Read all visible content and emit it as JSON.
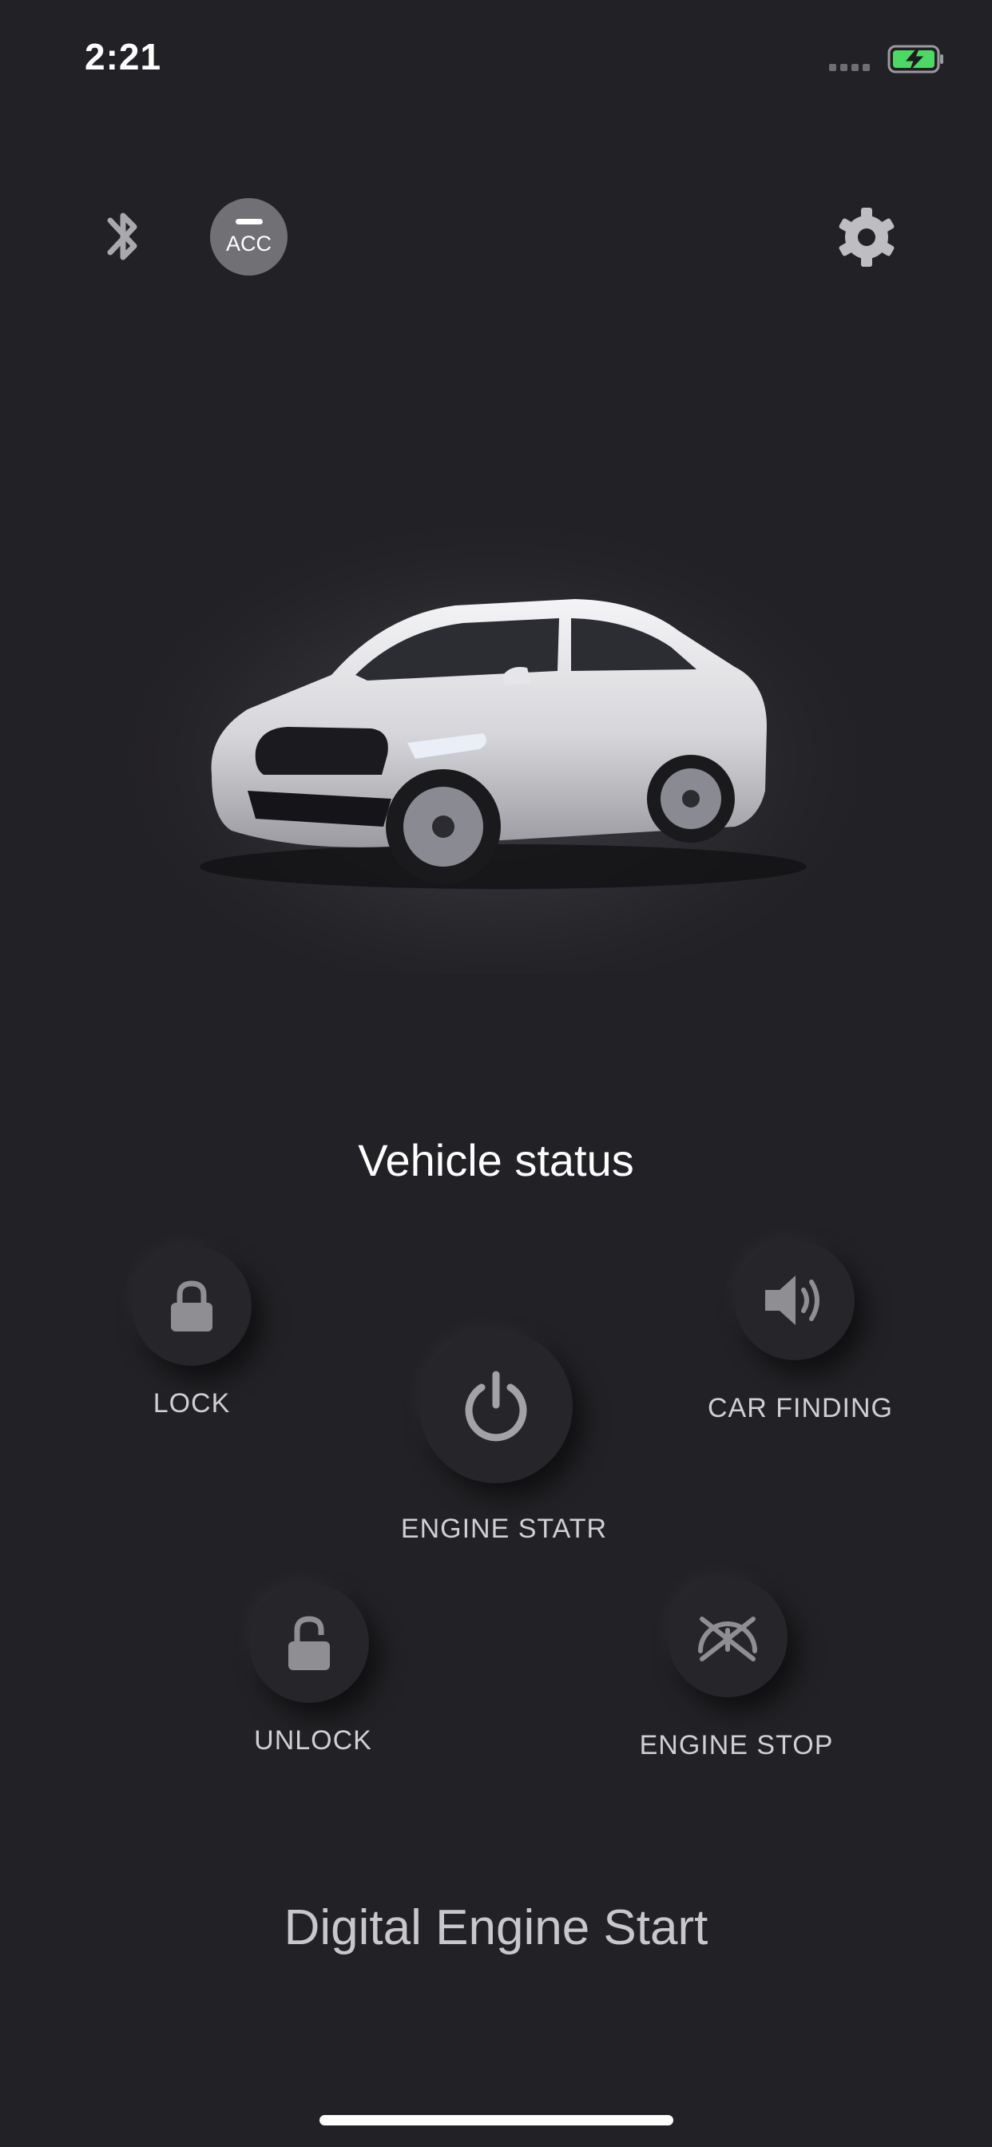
{
  "status_bar": {
    "time": "2:21"
  },
  "top_bar": {
    "acc_label": "ACC"
  },
  "vehicle": {
    "status_label": "Vehicle status"
  },
  "controls": {
    "lock": "LOCK",
    "car_finding": "CAR FINDING",
    "engine_start": "ENGINE STATR",
    "unlock": "UNLOCK",
    "engine_stop": "ENGINE STOP"
  },
  "footer": {
    "title": "Digital Engine Start"
  },
  "icons": {
    "status": [
      "signal-icon",
      "battery-charging-icon"
    ],
    "top": [
      "bluetooth-icon",
      "acc-icon",
      "gear-icon"
    ],
    "controls": [
      "lock-icon",
      "speaker-icon",
      "power-icon",
      "unlock-icon",
      "engine-stop-icon"
    ]
  },
  "colors": {
    "background": "#222125",
    "battery_fill": "#4cd964",
    "icon_gray": "#9b9ba0",
    "acc_button": "#707075"
  }
}
